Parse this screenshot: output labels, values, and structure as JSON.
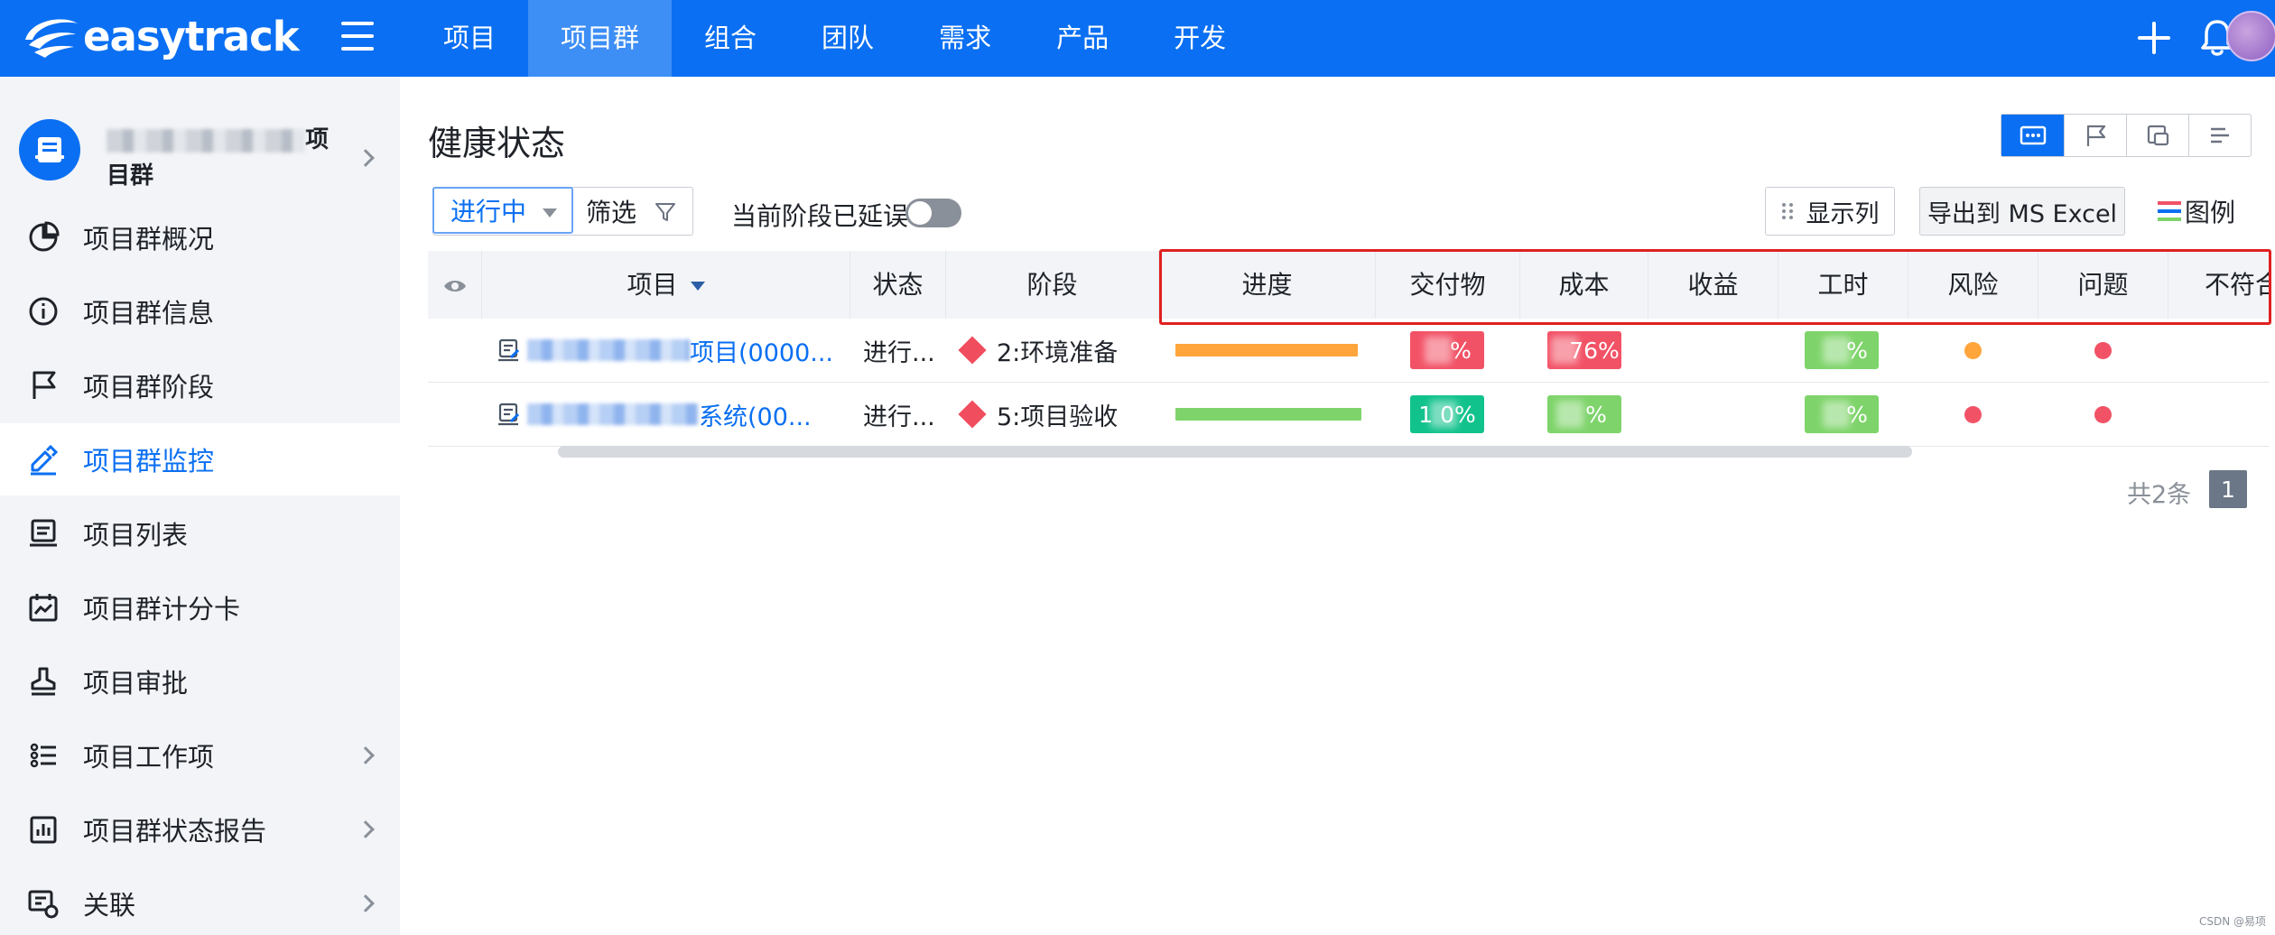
{
  "app": {
    "logo_text": "easytrack",
    "nav": [
      "项目",
      "项目群",
      "组合",
      "团队",
      "需求",
      "产品",
      "开发"
    ],
    "nav_active_index": 1,
    "brand_color": "#0a6ff2"
  },
  "sidebar": {
    "group_name_suffix": "项",
    "group_name_line2": "目群",
    "items": [
      {
        "label": "项目群概况",
        "icon": "pie-chart-icon",
        "has_arrow": false
      },
      {
        "label": "项目群信息",
        "icon": "info-icon",
        "has_arrow": false
      },
      {
        "label": "项目群阶段",
        "icon": "flag-icon",
        "has_arrow": false
      },
      {
        "label": "项目群监控",
        "icon": "monitor-icon",
        "has_arrow": false,
        "active": true
      },
      {
        "label": "项目列表",
        "icon": "list-board-icon",
        "has_arrow": false
      },
      {
        "label": "项目群计分卡",
        "icon": "scorecard-icon",
        "has_arrow": false
      },
      {
        "label": "项目审批",
        "icon": "stamp-icon",
        "has_arrow": false
      },
      {
        "label": "项目工作项",
        "icon": "task-list-icon",
        "has_arrow": true
      },
      {
        "label": "项目群状态报告",
        "icon": "report-icon",
        "has_arrow": true
      },
      {
        "label": "关联",
        "icon": "link-icon",
        "has_arrow": true
      }
    ]
  },
  "main": {
    "title": "健康状态",
    "status_filter": "进行中",
    "filter_label": "筛选",
    "delay_toggle_label": "当前阶段已延误",
    "delay_toggle_on": false,
    "columns_button": "显示列",
    "export_button": "导出到 MS Excel",
    "legend_button": "图例",
    "table": {
      "headers": [
        "项目",
        "状态",
        "阶段",
        "进度",
        "交付物",
        "成本",
        "收益",
        "工时",
        "风险",
        "问题",
        "不符合"
      ],
      "rows": [
        {
          "project": "项目(0000...",
          "status": "进行...",
          "stage": "2:环境准备",
          "progress_color": "#ffa53b",
          "deliverable": "%",
          "deliverable_color": "#f25266",
          "cost": "76%",
          "cost_color": "#f25266",
          "hours": "%",
          "hours_color": "#7ed46a",
          "risk_color": "#ffa53b",
          "issue_color": "#f25266"
        },
        {
          "project": "系统(00...",
          "status": "进行...",
          "stage": "5:项目验收",
          "progress_color": "#7ed46a",
          "deliverable": "1 0%",
          "deliverable_color": "#12c28c",
          "cost": "%",
          "cost_color": "#7ed46a",
          "hours": "%",
          "hours_color": "#7ed46a",
          "risk_color": "#f25266",
          "issue_color": "#f25266"
        }
      ]
    },
    "pager": {
      "total": "共2条",
      "page": "1"
    }
  },
  "watermark": "CSDN @易项"
}
